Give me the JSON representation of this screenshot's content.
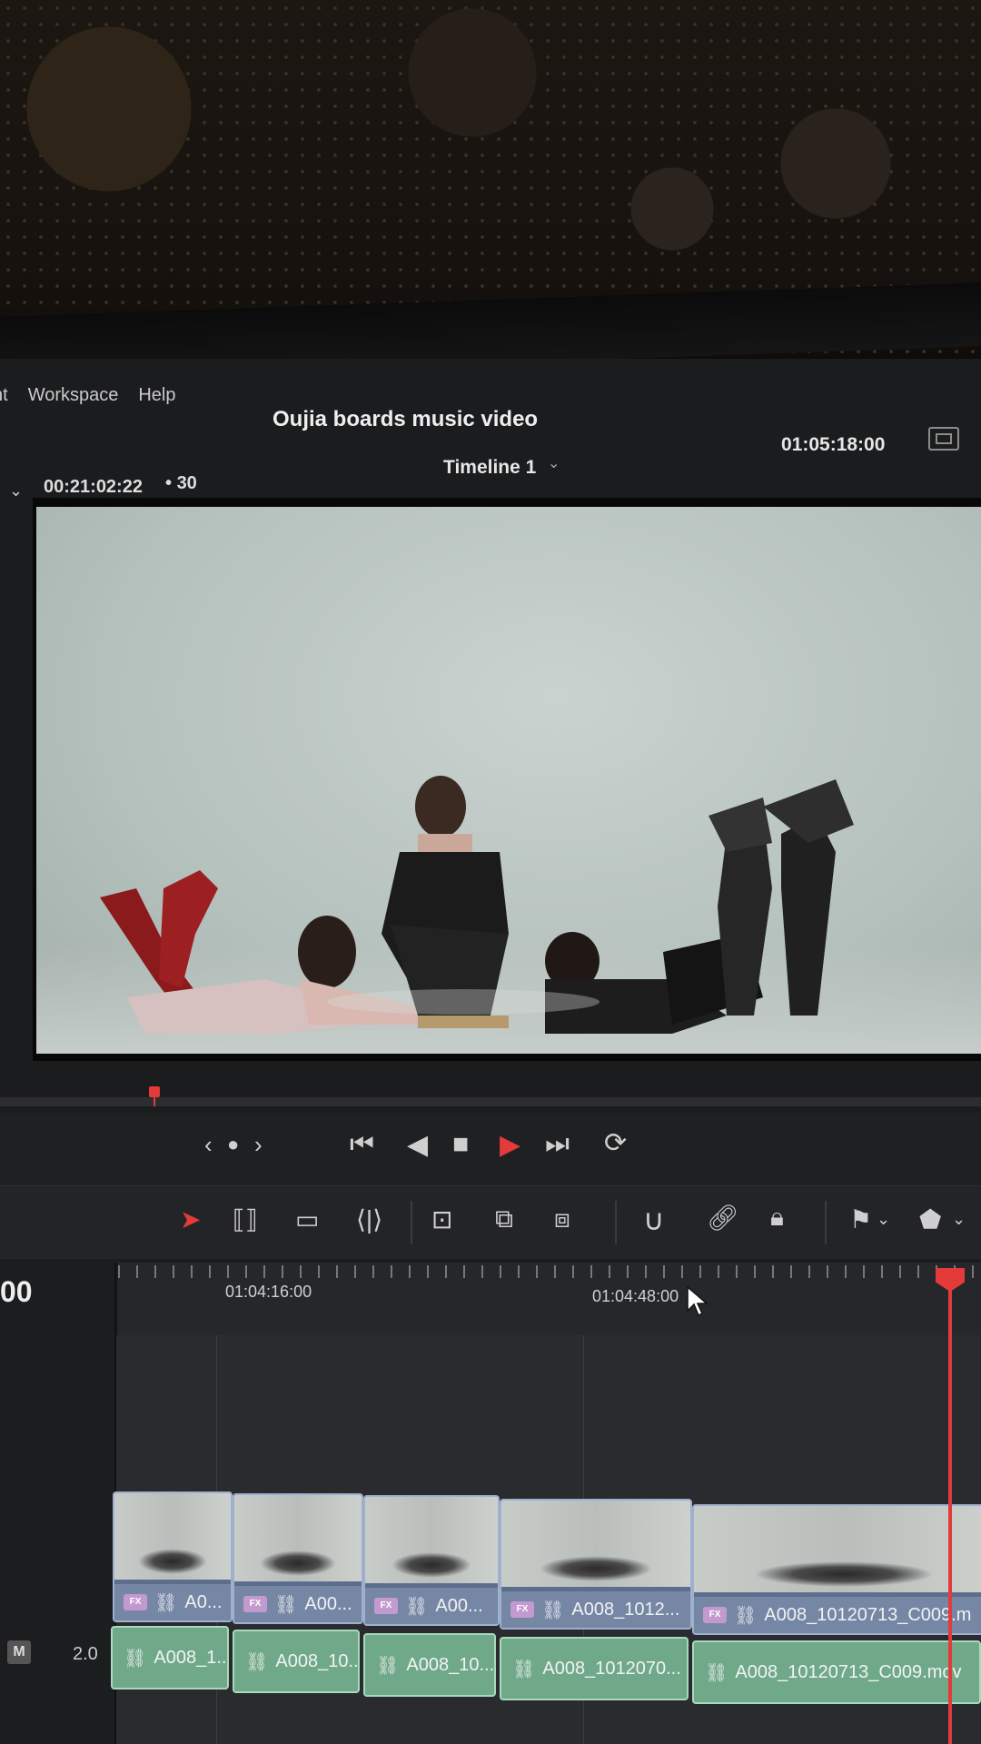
{
  "menu": {
    "items": [
      "ht",
      "Workspace",
      "Help"
    ]
  },
  "project": {
    "title": "Oujia boards music video"
  },
  "viewer": {
    "source_timecode": "00:21:02:22",
    "fps": "30",
    "timeline_name": "Timeline 1",
    "record_timecode": "01:05:18:00"
  },
  "transport": {
    "buttons": [
      "jog-prev",
      "jog-dot",
      "jog-next",
      "go-to-start",
      "play-reverse",
      "stop",
      "play",
      "go-to-end",
      "loop"
    ]
  },
  "toolbar": {
    "tools": [
      "selection",
      "trim-edit",
      "blade",
      "dynamic-trim",
      "overwrite-clip",
      "replace-clip",
      "ripple-overwrite",
      "snapping",
      "linked-selection",
      "position-lock",
      "flag",
      "marker"
    ]
  },
  "timeline": {
    "current_timecode": "00",
    "ruler_labels": [
      "01:04:16:00",
      "01:04:48:00"
    ],
    "audio_channel": "2.0",
    "audio_badge": "M",
    "video_clips": [
      {
        "label": "A0..."
      },
      {
        "label": "A00..."
      },
      {
        "label": "A00..."
      },
      {
        "label": "A008_1012..."
      },
      {
        "label": "A008_10120713_C009.m"
      }
    ],
    "audio_clips": [
      {
        "label": "A008_1..."
      },
      {
        "label": "A008_10..."
      },
      {
        "label": "A008_10..."
      },
      {
        "label": "A008_1012070..."
      },
      {
        "label": "A008_10120713_C009.mov"
      }
    ]
  },
  "colors": {
    "accent_red": "#e33a3a",
    "video_clip": "#7687a6",
    "audio_clip": "#6fa98a"
  }
}
